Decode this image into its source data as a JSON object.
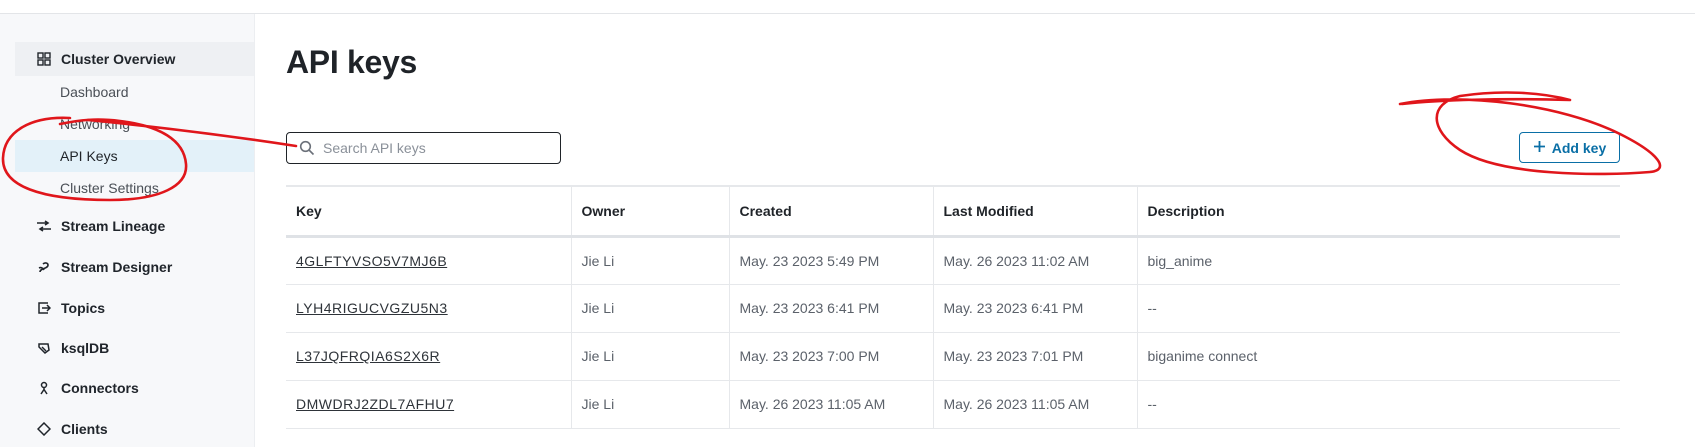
{
  "sidebar": {
    "cluster_overview": {
      "label": "Cluster Overview",
      "icon": "grid-icon"
    },
    "sub_items": [
      {
        "label": "Dashboard"
      },
      {
        "label": "Networking"
      },
      {
        "label": "API Keys",
        "selected": true
      },
      {
        "label": "Cluster Settings"
      }
    ],
    "sections": [
      {
        "label": "Stream Lineage",
        "icon": "lineage-icon"
      },
      {
        "label": "Stream Designer",
        "icon": "designer-icon"
      },
      {
        "label": "Topics",
        "icon": "topics-icon"
      },
      {
        "label": "ksqlDB",
        "icon": "ksqldb-icon"
      },
      {
        "label": "Connectors",
        "icon": "connectors-icon"
      },
      {
        "label": "Clients",
        "icon": "clients-icon"
      }
    ]
  },
  "main": {
    "title": "API keys",
    "search": {
      "placeholder": "Search API keys",
      "value": "",
      "icon": "search-icon"
    },
    "add_button": {
      "label": "Add key",
      "icon": "plus-icon"
    },
    "table": {
      "columns": [
        "Key",
        "Owner",
        "Created",
        "Last Modified",
        "Description"
      ],
      "rows": [
        {
          "key": "4GLFTYVSO5V7MJ6B",
          "owner": "Jie Li",
          "created": "May. 23 2023 5:49 PM",
          "modified": "May. 26 2023 11:02 AM",
          "description": "big_anime"
        },
        {
          "key": "LYH4RIGUCVGZU5N3",
          "owner": "Jie Li",
          "created": "May. 23 2023 6:41 PM",
          "modified": "May. 23 2023 6:41 PM",
          "description": "--"
        },
        {
          "key": "L37JQFRQIA6S2X6R",
          "owner": "Jie Li",
          "created": "May. 23 2023 7:00 PM",
          "modified": "May. 23 2023 7:01 PM",
          "description": "biganime connect"
        },
        {
          "key": "DMWDRJ2ZDL7AFHU7",
          "owner": "Jie Li",
          "created": "May. 26 2023 11:05 AM",
          "modified": "May. 26 2023 11:05 AM",
          "description": "--"
        }
      ]
    }
  },
  "colors": {
    "accent": "#0a6fa6",
    "selected_bg": "#e3f1f9",
    "annotation": "#e0161b"
  }
}
